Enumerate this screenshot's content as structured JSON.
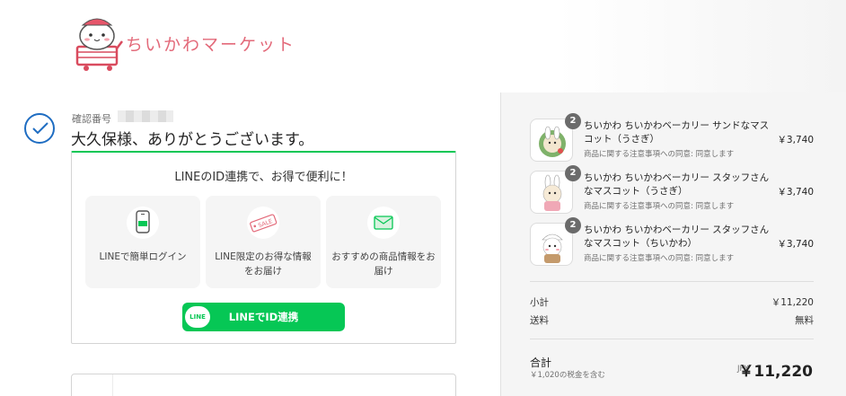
{
  "header": {
    "logo_text": "ちいかわマーケット"
  },
  "confirmation": {
    "label": "確認番号",
    "thanks": "大久保様、ありがとうございます。"
  },
  "line_promo": {
    "title": "LINEのID連携で、お得で便利に！",
    "cards": [
      {
        "label": "LINEで簡単ログイン",
        "icon": "phone-login-icon"
      },
      {
        "label": "LINE限定のお得な情報をお届け",
        "icon": "sale-tag-icon",
        "tag_text": "SALE"
      },
      {
        "label": "おすすめの商品情報をお届け",
        "icon": "mail-icon"
      }
    ],
    "button_badge": "LINE",
    "button_label": "LINEでID連携"
  },
  "summary": {
    "items": [
      {
        "qty": "2",
        "name": "ちいかわ ちいかわベーカリー サンドなマスコット（うさぎ）",
        "note": "商品に関する注意事項への同意: 同意します",
        "price": "￥3,740"
      },
      {
        "qty": "2",
        "name": "ちいかわ ちいかわベーカリー スタッフさんなマスコット（うさぎ）",
        "note": "商品に関する注意事項への同意: 同意します",
        "price": "￥3,740"
      },
      {
        "qty": "2",
        "name": "ちいかわ ちいかわベーカリー スタッフさんなマスコット（ちいかわ）",
        "note": "商品に関する注意事項への同意: 同意します",
        "price": "￥3,740"
      }
    ],
    "subtotal_label": "小計",
    "subtotal_value": "￥11,220",
    "shipping_label": "送料",
    "shipping_value": "無料",
    "total_label": "合計",
    "tax_note": "￥1,020の税金を含む",
    "currency": "JPY",
    "total_value": "￥11,220"
  },
  "colors": {
    "line_green": "#06c755",
    "check_blue": "#1f6dc2",
    "brand_pink": "#e36a7a"
  }
}
